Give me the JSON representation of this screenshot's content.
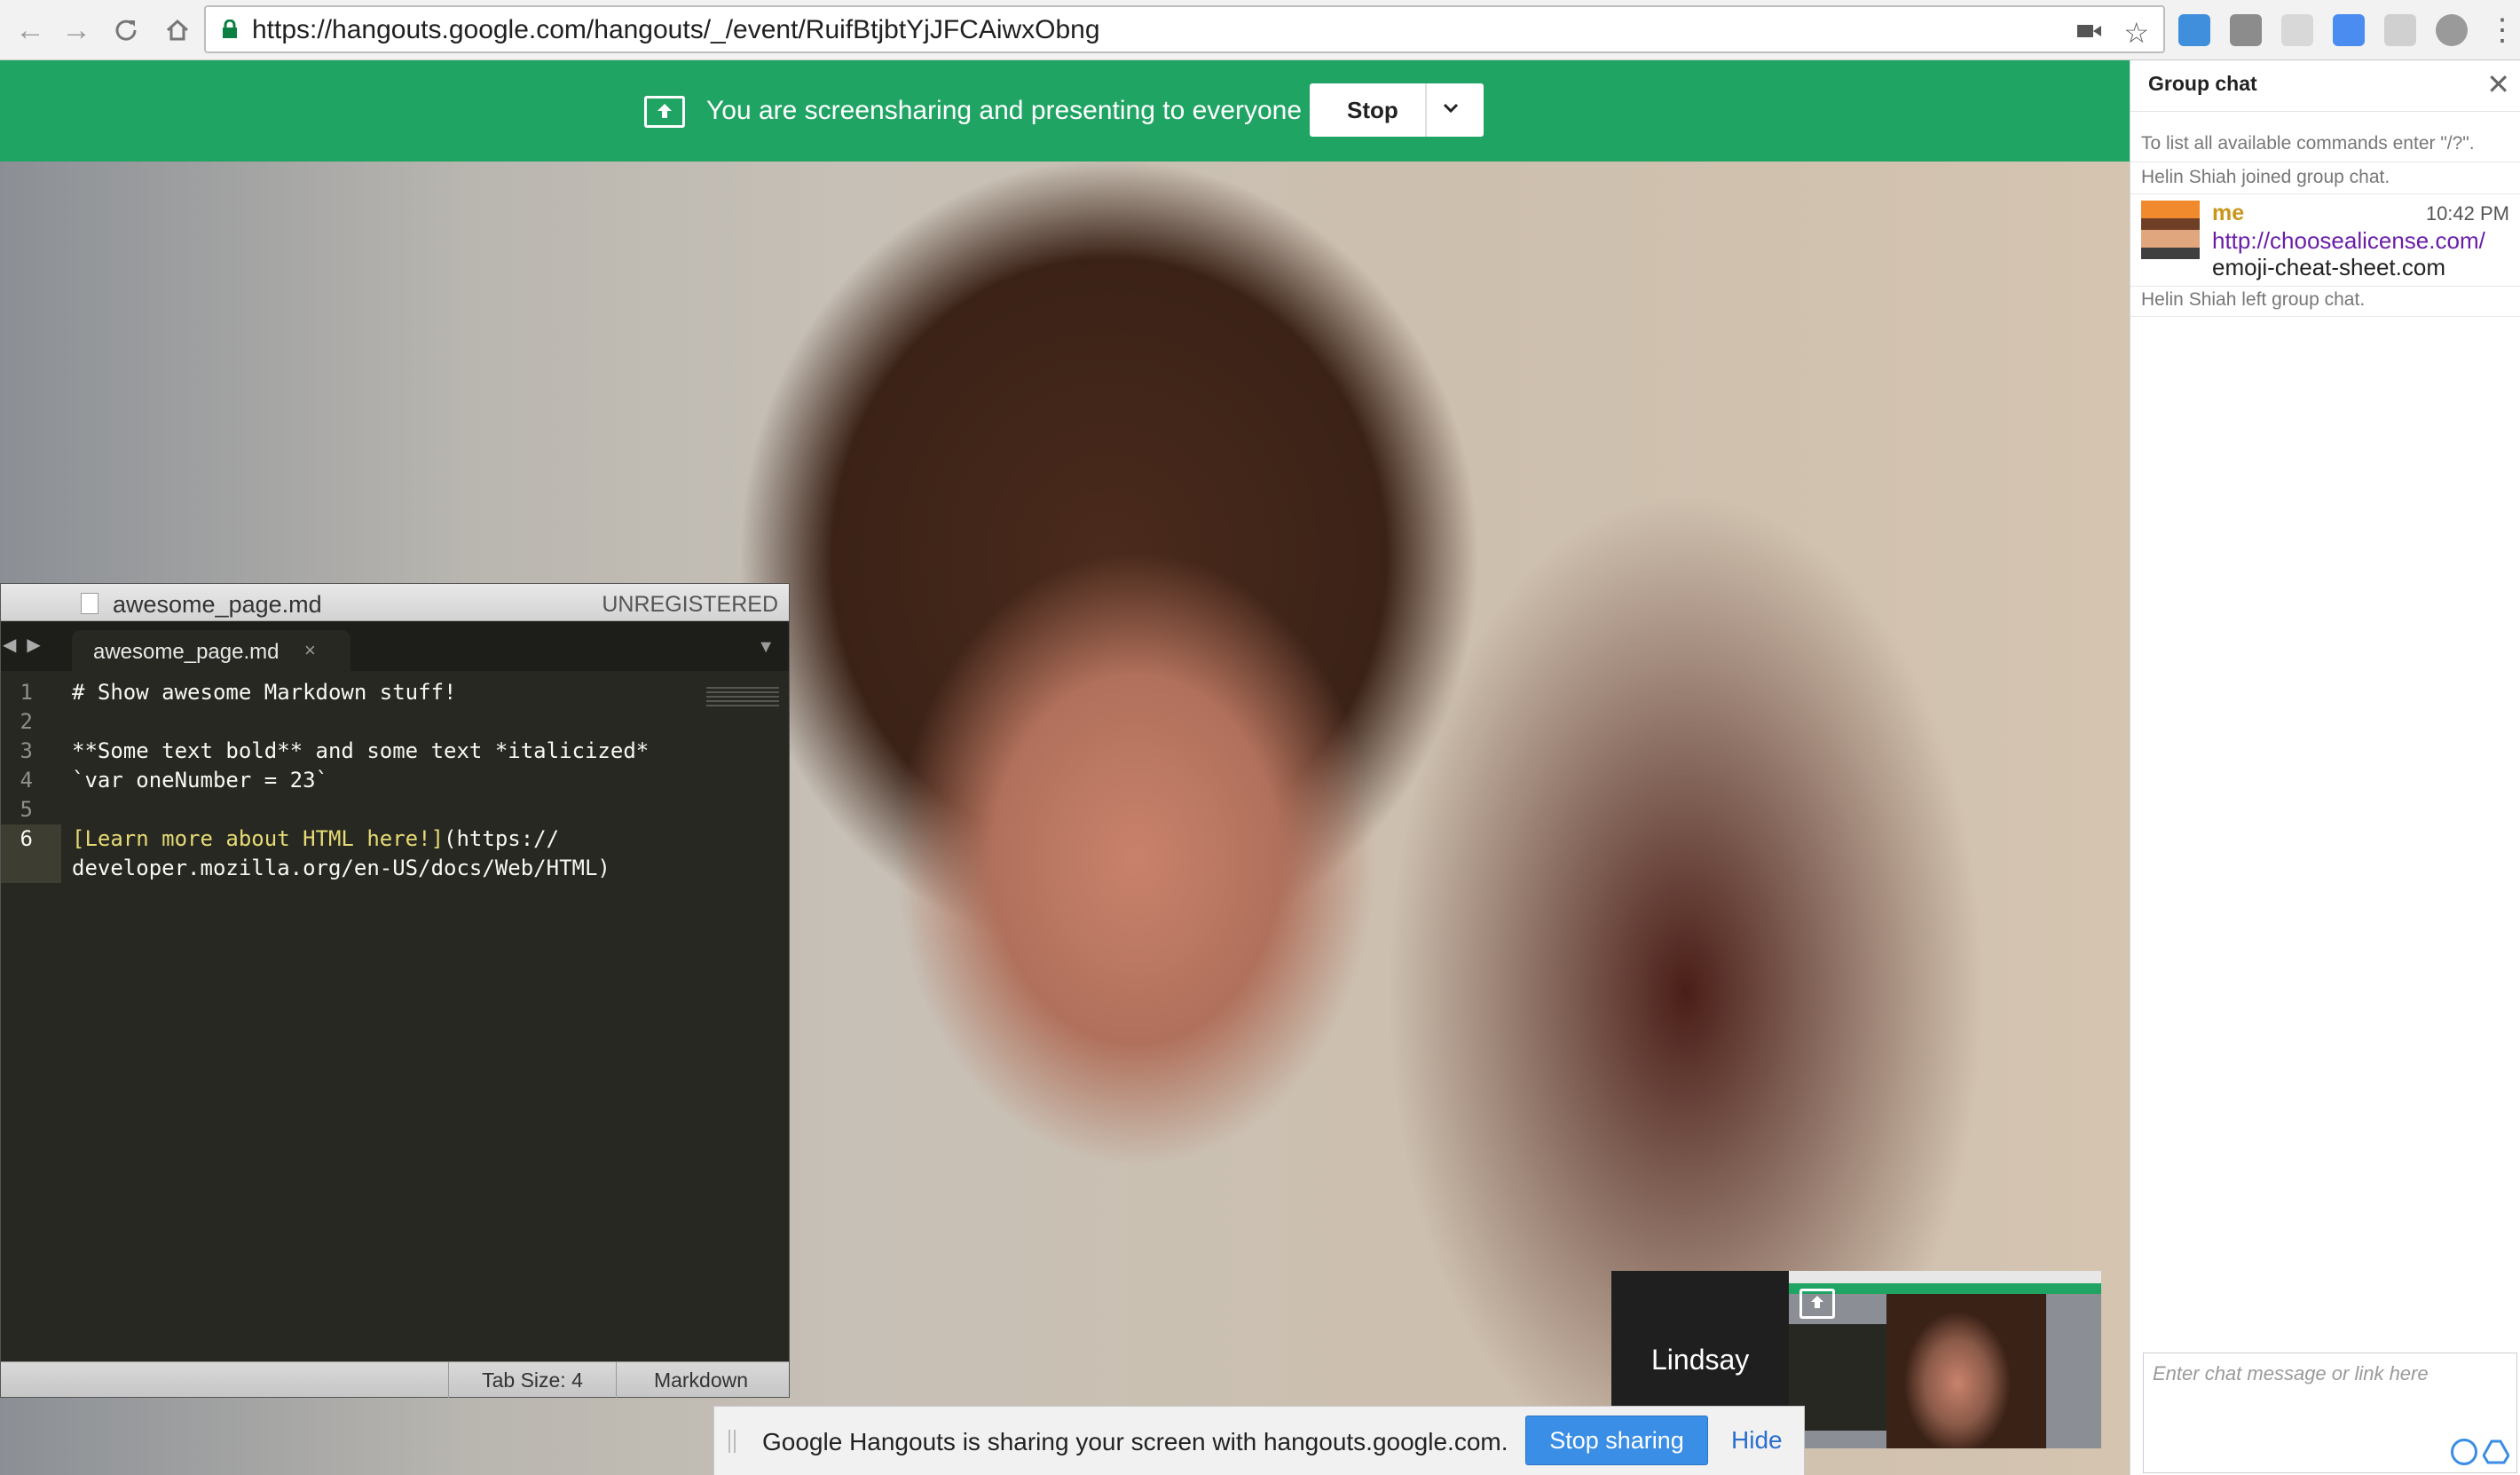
{
  "browser": {
    "url": "https://hangouts.google.com/hangouts/_/event/RuifBtjbtYjJFCAiwxObng"
  },
  "presenting_bar": {
    "message": "You are screensharing and presenting to everyone",
    "stop_label": "Stop"
  },
  "editor": {
    "title": "awesome_page.md",
    "registration": "UNREGISTERED",
    "tab_name": "awesome_page.md",
    "tab_close": "×",
    "lines": [
      {
        "num": "1",
        "text": "# Show awesome Markdown stuff!"
      },
      {
        "num": "2",
        "text": ""
      },
      {
        "num": "3",
        "text": "**Some text bold** and some text *italicized*"
      },
      {
        "num": "4",
        "text": "`var oneNumber = 23`"
      },
      {
        "num": "5",
        "text": ""
      },
      {
        "num": "6",
        "link_label": "[Learn more about HTML here!]",
        "link_url": "(https://",
        "continuation": "developer.mozilla.org/en-US/docs/Web/HTML)"
      }
    ],
    "status": {
      "tab_size": "Tab Size: 4",
      "syntax": "Markdown"
    }
  },
  "participant": {
    "name": "Lindsay"
  },
  "share_notice": {
    "message": "Google Hangouts is sharing your screen with hangouts.google.com.",
    "stop_label": "Stop sharing",
    "hide_label": "Hide"
  },
  "chat": {
    "title": "Group chat",
    "close": "✕",
    "help": "To list all available commands enter \"/?\".",
    "joined": "Helin Shiah joined group chat.",
    "message": {
      "sender": "me",
      "time": "10:42 PM",
      "link": "http://choosealicense.com/",
      "text": "emoji-cheat-sheet.com"
    },
    "left": "Helin Shiah left group chat.",
    "input_placeholder": "Enter chat message or link here"
  },
  "colors": {
    "hangouts_green": "#20a464",
    "link_purple": "#6a1ea8",
    "sender_gold": "#c8961a",
    "stop_sharing_blue": "#3a8ee6"
  }
}
